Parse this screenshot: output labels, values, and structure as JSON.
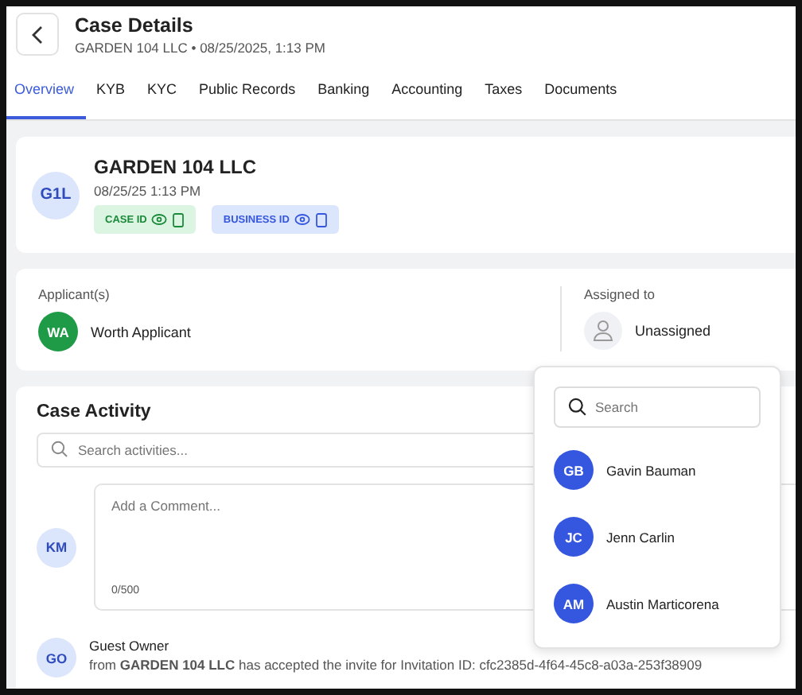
{
  "header": {
    "title": "Case Details",
    "subtitle": "GARDEN 104 LLC • 08/25/2025, 1:13 PM"
  },
  "tabs": [
    {
      "label": "Overview",
      "selected": true
    },
    {
      "label": "KYB",
      "selected": false
    },
    {
      "label": "KYC",
      "selected": false
    },
    {
      "label": "Public Records",
      "selected": false
    },
    {
      "label": "Banking",
      "selected": false
    },
    {
      "label": "Accounting",
      "selected": false
    },
    {
      "label": "Taxes",
      "selected": false
    },
    {
      "label": "Documents",
      "selected": false
    }
  ],
  "business": {
    "initials": "G1L",
    "name": "GARDEN 104 LLC",
    "date": "08/25/25 1:13 PM",
    "badges": [
      {
        "label": "CASE ID",
        "kind": "case"
      },
      {
        "label": "BUSINESS ID",
        "kind": "business"
      }
    ]
  },
  "applicants": {
    "label": "Applicant(s)",
    "initials": "WA",
    "name": "Worth Applicant"
  },
  "assigned": {
    "label": "Assigned to",
    "name": "Unassigned"
  },
  "activity": {
    "title": "Case Activity",
    "search_placeholder": "Search activities...",
    "comment_initials": "KM",
    "comment_placeholder": "Add a Comment...",
    "counter": "0/500",
    "entries": [
      {
        "initials": "GO",
        "author": "Guest Owner",
        "text": "from **GARDEN 104 LLC** has accepted the invite for Invitation ID: cfc2385d-4f64-45c8-a03a-253f38909"
      }
    ]
  },
  "dropdown": {
    "search_placeholder": "Search",
    "users": [
      {
        "initials": "GB",
        "name": "Gavin Bauman"
      },
      {
        "initials": "JC",
        "name": "Jenn Carlin"
      },
      {
        "initials": "AM",
        "name": "Austin Marticorena"
      }
    ]
  }
}
